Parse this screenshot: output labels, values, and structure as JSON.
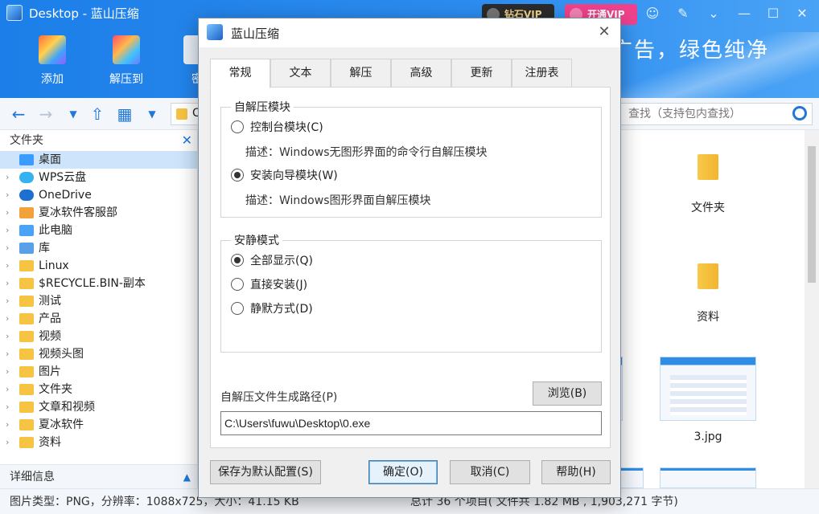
{
  "window": {
    "title": "Desktop - 蓝山压缩",
    "vip_gold": "钻石VIP",
    "vip_pink": "开通VIP",
    "slogan": "广告，绿色纯净"
  },
  "toolbar": {
    "add_label": "添加",
    "extract_label": "解压到",
    "encrypt_label": "密"
  },
  "address": {
    "path_text": "C",
    "search_placeholder": "查找（支持包内查找）"
  },
  "sidebar": {
    "title": "文件夹",
    "items": [
      {
        "label": "桌面",
        "icon": "desktop-icon"
      },
      {
        "label": "WPS云盘",
        "icon": "cloud-icon"
      },
      {
        "label": "OneDrive",
        "icon": "onedrive-icon"
      },
      {
        "label": "夏冰软件客服部",
        "icon": "user-folder-icon"
      },
      {
        "label": "此电脑",
        "icon": "computer-icon"
      },
      {
        "label": "库",
        "icon": "library-icon"
      },
      {
        "label": "Linux",
        "icon": "folder-icon"
      },
      {
        "label": "$RECYCLE.BIN-副本",
        "icon": "folder-icon"
      },
      {
        "label": "测试",
        "icon": "folder-icon"
      },
      {
        "label": "产品",
        "icon": "folder-icon"
      },
      {
        "label": "视频",
        "icon": "folder-icon"
      },
      {
        "label": "视频头图",
        "icon": "folder-icon"
      },
      {
        "label": "图片",
        "icon": "folder-icon"
      },
      {
        "label": "文件夹",
        "icon": "folder-icon"
      },
      {
        "label": "文章和视频",
        "icon": "folder-icon"
      },
      {
        "label": "夏冰软件",
        "icon": "folder-icon"
      },
      {
        "label": "资料",
        "icon": "folder-icon"
      }
    ],
    "detail_label": "详细信息"
  },
  "filepane": {
    "items": [
      "文件夹",
      "资料",
      "3.jpg"
    ]
  },
  "status": {
    "left": "图片类型：PNG，分辨率：1088x725，大小：41.15 KB",
    "right": "总计 36 个项目( 文件共 1.82 MB , 1,903,271 字节)"
  },
  "dialog": {
    "title": "蓝山压缩",
    "tabs": [
      "常规",
      "文本",
      "解压",
      "高级",
      "更新",
      "注册表"
    ],
    "group1": {
      "legend": "自解压模块",
      "opt1": "控制台模块(C)",
      "desc1": "描述：Windows无图形界面的命令行自解压模块",
      "opt2": "安装向导模块(W)",
      "desc2": "描述：Windows图形界面自解压模块"
    },
    "group2": {
      "legend": "安静模式",
      "opt1": "全部显示(Q)",
      "opt2": "直接安装(J)",
      "opt3": "静默方式(D)"
    },
    "path_label": "自解压文件生成路径(P)",
    "browse": "浏览(B)",
    "path_value": "C:\\Users\\fuwu\\Desktop\\0.exe",
    "btn_default": "保存为默认配置(S)",
    "btn_ok": "确定(O)",
    "btn_cancel": "取消(C)",
    "btn_help": "帮助(H)"
  }
}
